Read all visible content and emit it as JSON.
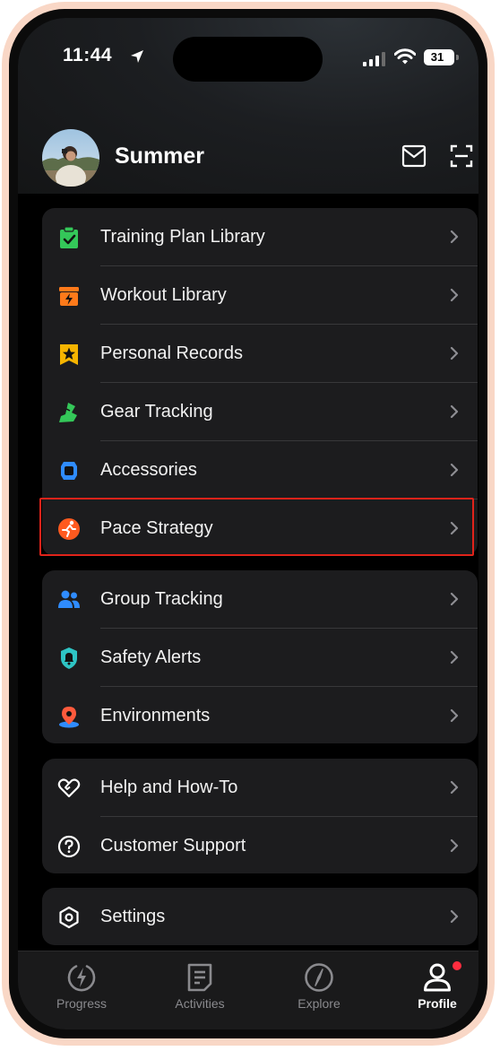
{
  "status_bar": {
    "time": "11:44",
    "battery": "31"
  },
  "profile": {
    "name": "Summer"
  },
  "menu_groups": [
    {
      "items": [
        {
          "label": "Training Plan Library",
          "icon": "clipboard-check-icon"
        },
        {
          "label": "Workout Library",
          "icon": "lightning-box-icon"
        },
        {
          "label": "Personal Records",
          "icon": "star-icon"
        },
        {
          "label": "Gear Tracking",
          "icon": "shoe-icon"
        },
        {
          "label": "Accessories",
          "icon": "watch-icon"
        },
        {
          "label": "Pace Strategy",
          "icon": "runner-icon"
        }
      ]
    },
    {
      "items": [
        {
          "label": "Group Tracking",
          "icon": "group-icon"
        },
        {
          "label": "Safety Alerts",
          "icon": "bell-shield-icon"
        },
        {
          "label": "Environments",
          "icon": "location-pin-icon"
        }
      ]
    },
    {
      "items": [
        {
          "label": "Help and How-To",
          "icon": "heart-hands-icon"
        },
        {
          "label": "Customer Support",
          "icon": "question-circle-icon"
        }
      ]
    },
    {
      "items": [
        {
          "label": "Settings",
          "icon": "hexagon-gear-icon"
        }
      ]
    }
  ],
  "tabs": [
    {
      "label": "Progress",
      "icon": "lightning-circle-icon",
      "active": false
    },
    {
      "label": "Activities",
      "icon": "document-icon",
      "active": false
    },
    {
      "label": "Explore",
      "icon": "compass-icon",
      "active": false
    },
    {
      "label": "Profile",
      "icon": "person-icon",
      "active": true
    }
  ],
  "colors": {
    "accent_green": "#34c759",
    "accent_orange": "#ff7a1a",
    "accent_yellow": "#f5b400",
    "accent_blue": "#2f8cff",
    "accent_teal": "#2ec4c4",
    "highlight_red": "#e0231a",
    "notification_red": "#ff2d3f"
  }
}
